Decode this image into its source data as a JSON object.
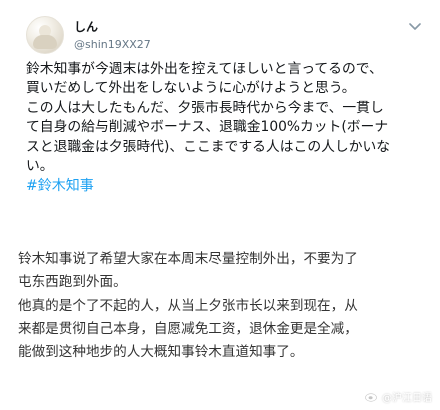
{
  "tweet": {
    "display_name": "しん",
    "handle": "@shin19XX27",
    "lines": [
      "鈴木知事が今週末は外出を控えてほしいと言ってるので、",
      "買いだめして外出をしないように心がけようと思う。",
      "この人は大したもんだ、夕張市長時代から今まで、一貫し",
      "て自身の給与削減やボーナス、退職金100%カット(ボーナ",
      "スと退職金は夕張時代)、ここまでする人はこの人しかいな",
      "い。"
    ],
    "hashtag": "#鈴木知事"
  },
  "translation": {
    "lines": [
      "铃木知事说了希望大家在本周末尽量控制外出，不要为了",
      "屯东西跑到外面。",
      "他真的是个了不起的人，从当上夕张市长以来到现在，从",
      "来都是贯彻自己本身，自愿减免工资，退休金更是全减，",
      "能做到这种地步的人大概知事铃木直道知事了。"
    ]
  },
  "watermark": {
    "icon": "weibo-icon",
    "text": "@沪江日语"
  },
  "colors": {
    "hashtag": "#1da1f2",
    "handle": "#657786",
    "tweet_text": "#14171a",
    "translation_text": "#333333"
  }
}
